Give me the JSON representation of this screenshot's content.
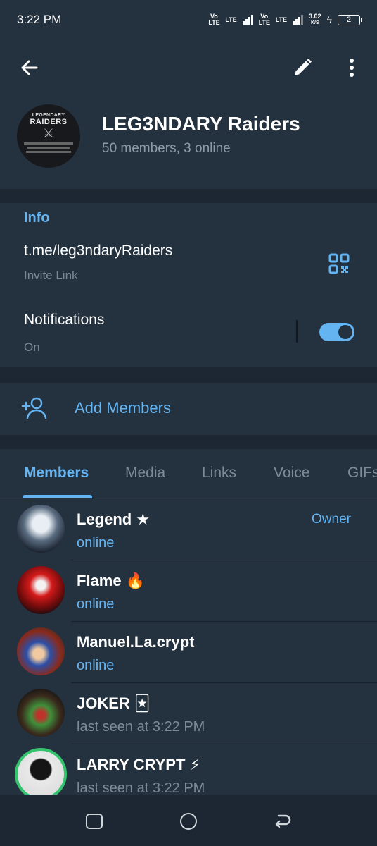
{
  "status_bar": {
    "time": "3:22 PM",
    "net1": "Vo LTE",
    "net2": "LTE",
    "net3": "Vo LTE",
    "net4": "LTE",
    "speed": "3.02",
    "speed_unit": "K/S",
    "battery": "2"
  },
  "header": {
    "group_name": "LEG3NDARY Raiders",
    "subtitle": "50 members, 3 online",
    "avatar_line1": "LEGENDARY",
    "avatar_line2": "RAIDERS"
  },
  "info": {
    "title": "Info",
    "link": "t.me/leg3ndaryRaiders",
    "link_caption": "Invite Link",
    "notifications_label": "Notifications",
    "notifications_value": "On",
    "notifications_enabled": true
  },
  "add_members": {
    "label": "Add Members"
  },
  "tabs": [
    {
      "label": "Members",
      "active": true
    },
    {
      "label": "Media",
      "active": false
    },
    {
      "label": "Links",
      "active": false
    },
    {
      "label": "Voice",
      "active": false
    },
    {
      "label": "GIFs",
      "active": false
    }
  ],
  "members": [
    {
      "name": "Legend ★",
      "status": "online",
      "role": "Owner"
    },
    {
      "name": "Flame 🔥",
      "status": "online",
      "role": ""
    },
    {
      "name": "Manuel.La.crypt",
      "status": "online",
      "role": ""
    },
    {
      "name": "JOKER 🃏",
      "status": "last seen at 3:22 PM",
      "role": ""
    },
    {
      "name": "LARRY CRYPT ⚡",
      "status": "last seen at 3:22 PM",
      "role": ""
    }
  ],
  "colors": {
    "accent": "#64b4f2",
    "background": "#1c2733",
    "card": "#243240"
  }
}
